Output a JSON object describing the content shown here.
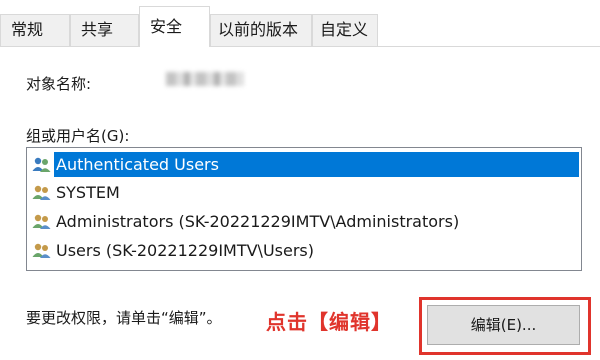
{
  "tabs": [
    {
      "label": "常规"
    },
    {
      "label": "共享"
    },
    {
      "label": "安全"
    },
    {
      "label": "以前的版本"
    },
    {
      "label": "自定义"
    }
  ],
  "active_tab": "安全",
  "object_name_label": "对象名称:",
  "group_label": "组或用户名(G):",
  "users": [
    {
      "name": "Authenticated Users",
      "selected": true
    },
    {
      "name": "SYSTEM",
      "selected": false
    },
    {
      "name": "Administrators (SK-20221229IMTV\\Administrators)",
      "selected": false
    },
    {
      "name": "Users (SK-20221229IMTV\\Users)",
      "selected": false
    }
  ],
  "hint_text": "要更改权限，请单击“编辑”。",
  "callout_text": "点击【编辑】",
  "edit_button_label": "编辑(E)...",
  "colors": {
    "selection": "#0078d7",
    "callout": "#e0342c"
  }
}
